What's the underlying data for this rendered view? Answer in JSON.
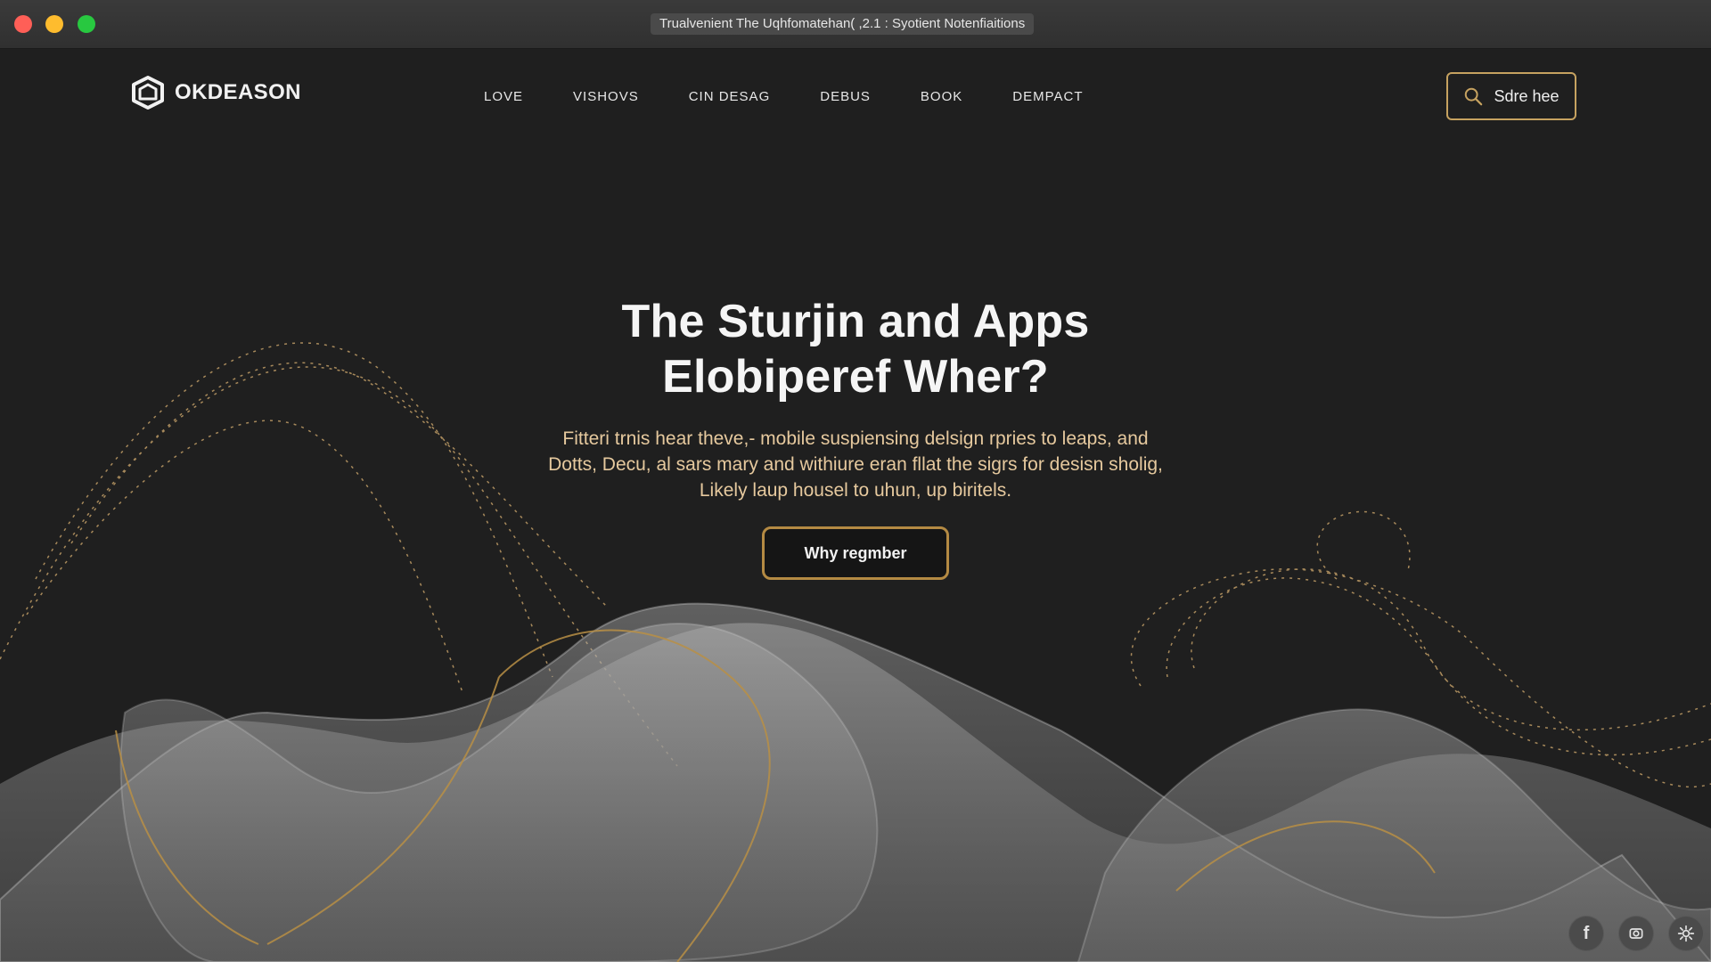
{
  "window": {
    "title": "Trualvenient The Uqhfomatehan( ,2.1 : Syotient Notenfiaitions"
  },
  "header": {
    "brand_name": "OKDEASON",
    "nav_items": [
      "LOVE",
      "VISHOVS",
      "CIN DESAG",
      "DEBUS",
      "BOOK",
      "DEMPACT"
    ],
    "search_label": "Sdre hee"
  },
  "hero": {
    "title_line_1": "The Sturjin and Apps",
    "title_line_2": "Elobiperef Wher?",
    "body_line_1": "Fitteri trnis hear theve,- mobile suspiensing delsign rpries to leaps, and",
    "body_line_2": "Dotts, Decu, al sars mary and withiure eran fllat the sigrs for desisn sholig,",
    "body_line_3": "Likely laup housel to uhun, up biritels.",
    "cta_label": "Why regmber"
  },
  "social_icons": [
    "facebook-icon",
    "camera-icon",
    "gear-icon"
  ],
  "colors": {
    "background": "#1f1f1f",
    "accent_gold": "#c6a260",
    "hero_text": "#e6c99e"
  }
}
